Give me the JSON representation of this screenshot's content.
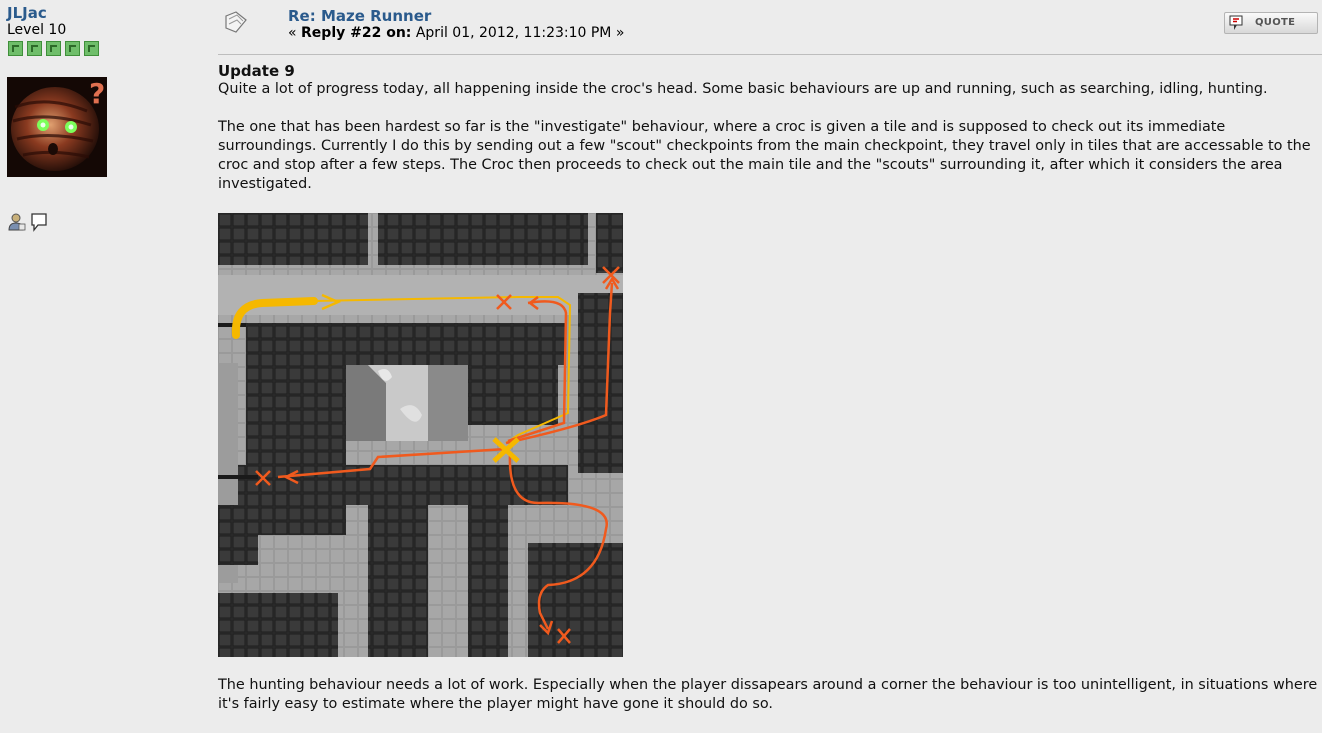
{
  "poster": {
    "name": "JLJac",
    "level": "Level 10",
    "star_count": 5
  },
  "post": {
    "title": "Re: Maze Runner",
    "reply_label": "Reply #22 on:",
    "date": "April 01, 2012, 11:23:10 PM",
    "quote_label": "QUOTE"
  },
  "content": {
    "heading": "Update 9",
    "p1": "Quite a lot of progress today, all happening inside the croc's head. Some basic behaviours are up and running, such as searching, idling, hunting.",
    "p2": "The one that has been hardest so far is the \"investigate\" behaviour, where a croc is given a tile and is supposed to check out its immediate surroundings. Currently I do this by sending out a few \"scout\" checkpoints from the main checkpoint, they travel only in tiles that are accessable to the croc and stop after a few steps. The Croc then proceeds to check out the main tile and the \"scouts\" surrounding it, after which it considers the area investigated.",
    "p3": "The hunting behaviour needs a lot of work. Especially when the player dissapears around a corner the behaviour is too unintelligent, in situations where it's fairly easy to estimate where the player might have gone it should do so."
  },
  "icons": {
    "message": "message-icon",
    "quote": "quote-icon",
    "profile": "profile-icon",
    "pm": "speech-bubble-icon"
  },
  "colors": {
    "link": "#2a5a8c",
    "background": "#ececec",
    "path_orange": "#f05a1e",
    "path_yellow": "#f5b800"
  }
}
